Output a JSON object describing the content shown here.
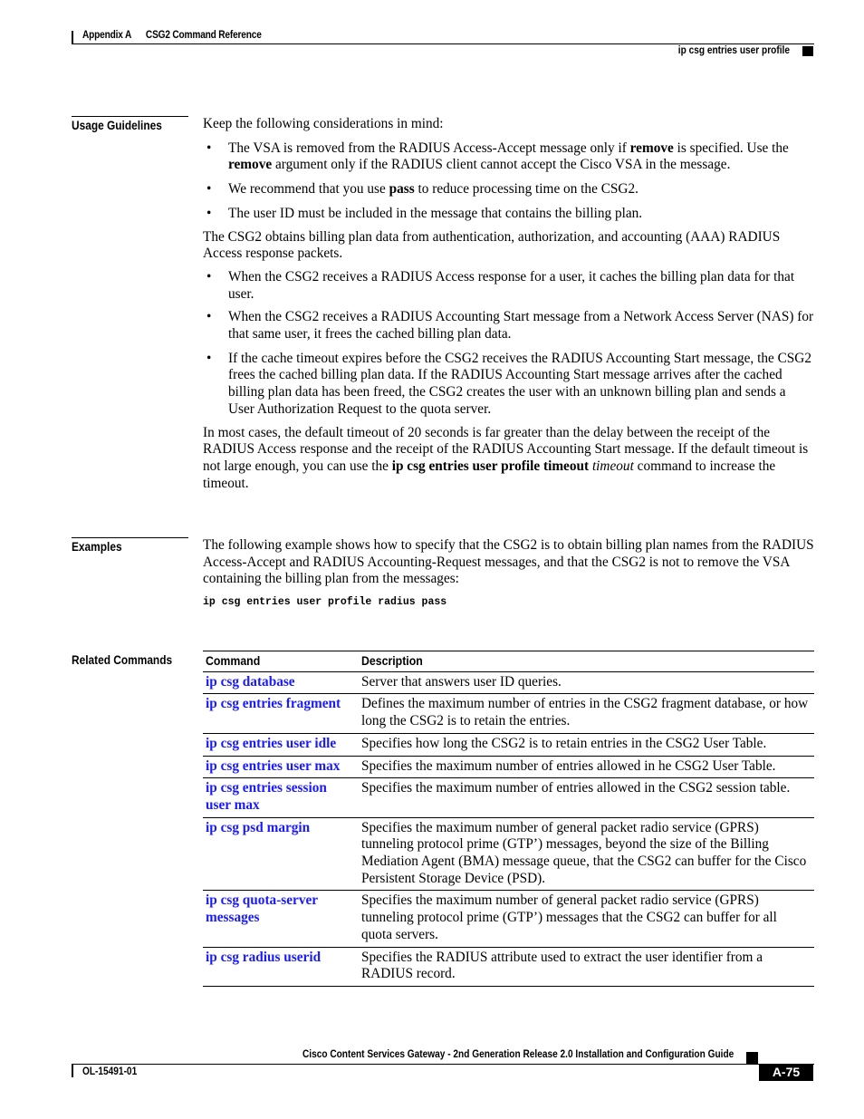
{
  "header": {
    "appendix": "Appendix A",
    "chapter": "CSG2 Command Reference",
    "topic": "ip csg entries user profile"
  },
  "usage": {
    "heading": "Usage Guidelines",
    "intro": "Keep the following considerations in mind:",
    "bullets1": [
      {
        "parts": [
          "The VSA is removed from the RADIUS Access-Accept message only if ",
          "remove",
          " is specified. Use the ",
          "remove",
          " argument only if the RADIUS client cannot accept the Cisco VSA in the message."
        ]
      },
      {
        "parts": [
          "We recommend that you use ",
          "pass",
          " to reduce processing time on the CSG2."
        ]
      },
      {
        "text": "The user ID must be included in the message that contains the billing plan."
      }
    ],
    "para2": "The CSG2 obtains billing plan data from authentication, authorization, and accounting (AAA) RADIUS Access response packets.",
    "bullets2": [
      "When the CSG2 receives a RADIUS Access response for a user, it caches the billing plan data for that user.",
      "When the CSG2 receives a RADIUS Accounting Start message from a Network Access Server (NAS) for that same user, it frees the cached billing plan data.",
      "If the cache timeout expires before the CSG2 receives the RADIUS Accounting Start message, the CSG2 frees the cached billing plan data. If the RADIUS Accounting Start message arrives after the cached billing plan data has been freed, the CSG2 creates the user with an unknown billing plan and sends a User Authorization Request to the quota server."
    ],
    "para3_a": "In most cases, the default timeout of 20 seconds is far greater than the delay between the receipt of the RADIUS Access response and the receipt of the RADIUS Accounting Start message. If the default timeout is not large enough, you can use the ",
    "para3_cmd": "ip csg entries user profile timeout",
    "para3_arg": "timeout",
    "para3_b": " command to increase the timeout."
  },
  "examples": {
    "heading": "Examples",
    "text": "The following example shows how to specify that the CSG2 is to obtain billing plan names from the RADIUS Access-Accept and RADIUS Accounting-Request messages, and that the CSG2 is not to remove the VSA containing the billing plan from the messages:",
    "code": "ip csg entries user profile radius pass"
  },
  "related": {
    "heading": "Related Commands",
    "col_command": "Command",
    "col_description": "Description",
    "rows": [
      {
        "command": "ip csg database",
        "description": "Server that answers user ID queries."
      },
      {
        "command": "ip csg entries fragment",
        "description": "Defines the maximum number of entries in the CSG2 fragment database, or how long the CSG2 is to retain the entries."
      },
      {
        "command": "ip csg entries user idle",
        "description": "Specifies how long the CSG2 is to retain entries in the CSG2 User Table."
      },
      {
        "command": "ip csg entries user max",
        "description": "Specifies the maximum number of entries allowed in he CSG2 User Table."
      },
      {
        "command": "ip csg entries session user max",
        "description": "Specifies the maximum number of entries allowed in the CSG2 session table."
      },
      {
        "command": "ip csg psd margin",
        "description": "Specifies the maximum number of general packet radio service (GPRS) tunneling protocol prime (GTP’) messages, beyond the size of the Billing Mediation Agent (BMA) message queue, that the CSG2 can buffer for the Cisco Persistent Storage Device (PSD)."
      },
      {
        "command": "ip csg quota-server messages",
        "description": "Specifies the maximum number of general packet radio service (GPRS) tunneling protocol prime (GTP’) messages that the CSG2 can buffer for all quota servers."
      },
      {
        "command": "ip csg radius userid",
        "description": "Specifies the RADIUS attribute used to extract the user identifier from a RADIUS record."
      }
    ]
  },
  "footer": {
    "title": "Cisco Content Services Gateway - 2nd Generation Release 2.0 Installation and Configuration Guide",
    "doc_number": "OL-15491-01",
    "page": "A-75"
  },
  "colors": {
    "link": "#1a1aff",
    "text": "#000000"
  }
}
